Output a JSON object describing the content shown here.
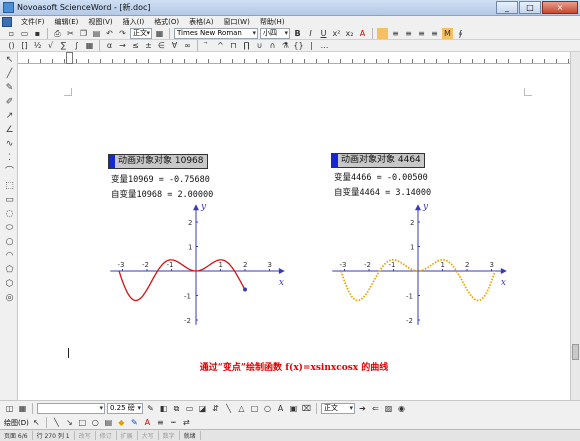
{
  "window": {
    "title": "Novoasoft ScienceWord - [新.doc]",
    "buttons": [
      "_",
      "□",
      "×"
    ]
  },
  "menu": [
    "文件(F)",
    "编辑(E)",
    "视图(V)",
    "插入(I)",
    "格式(O)",
    "表格(A)",
    "窗口(W)",
    "帮助(H)"
  ],
  "toolbar": {
    "style_value": "正文",
    "font_value": "Times New Roman",
    "size_value": "小四",
    "bold": "B",
    "italic": "I",
    "underline": "U"
  },
  "objects": [
    {
      "label": "动画对象对象 10968",
      "var_line": "变量10969 = -0.75680",
      "self_line": "自变量10968 = 2.00000"
    },
    {
      "label": "动画对象对象 4464",
      "var_line": "变量4466 = -0.00500",
      "self_line": "自变量4464 = 3.14000"
    }
  ],
  "graph_labels": {
    "x": "x",
    "y": "y"
  },
  "chart_data": [
    {
      "type": "line",
      "series": [
        {
          "function": "y = x·sin(x)·cos(x)",
          "style": "solid",
          "color": "#d81010",
          "x_from": -3.14,
          "x_to": 2.0
        }
      ],
      "marker": {
        "x": 2.0,
        "y": -0.7568
      },
      "xlim": [
        -3.5,
        3.3
      ],
      "ylim": [
        -2.2,
        2.4
      ],
      "xticks": [
        -3,
        -2,
        -1,
        1,
        2,
        3
      ],
      "yticks": [
        -2,
        -1,
        1,
        2
      ],
      "xlabel": "x",
      "ylabel": "y",
      "grid": false
    },
    {
      "type": "line",
      "series": [
        {
          "function": "y = x·sin(x)·cos(x)",
          "style": "dotted",
          "color": "#e8a400",
          "x_from": -3.14,
          "x_to": 3.14
        }
      ],
      "xlim": [
        -3.5,
        3.3
      ],
      "ylim": [
        -2.2,
        2.4
      ],
      "xticks": [
        -3,
        -2,
        -1,
        1,
        2,
        3
      ],
      "yticks": [
        -2,
        -1,
        1,
        2
      ],
      "xlabel": "x",
      "ylabel": "y",
      "grid": false
    }
  ],
  "caption": "通过“变点”绘制函数 f(x)=xsinxcosx 的曲线",
  "bottom_toolbar": {
    "line_width": "0.25 磅",
    "style_value": "正文"
  },
  "draw_toolbar": {
    "label": "绘图(D)"
  },
  "status": [
    "页面 6/6",
    "行 270 列 1",
    "改写",
    "修订",
    "扩展",
    "大写",
    "数字",
    "就绪"
  ]
}
